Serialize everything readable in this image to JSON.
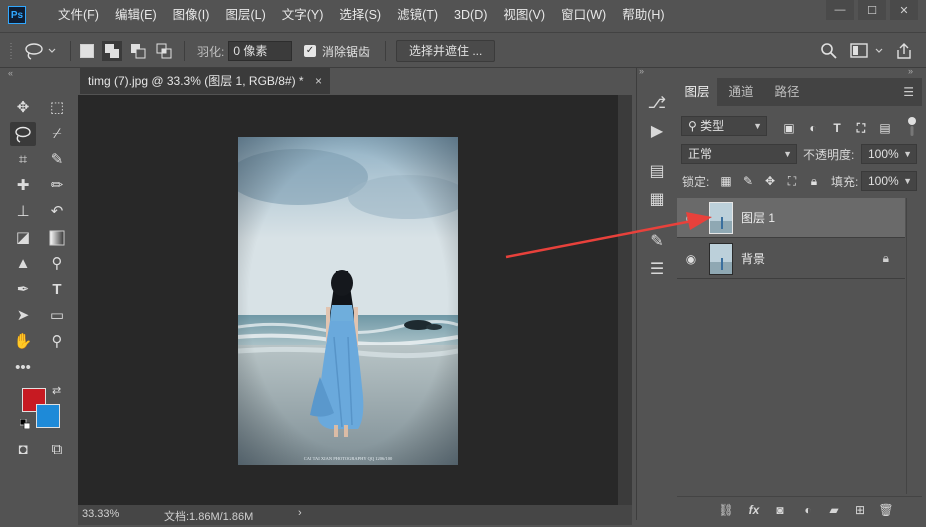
{
  "app": {
    "logo": "Ps"
  },
  "menu": [
    "文件(F)",
    "编辑(E)",
    "图像(I)",
    "图层(L)",
    "文字(Y)",
    "选择(S)",
    "滤镜(T)",
    "3D(D)",
    "视图(V)",
    "窗口(W)",
    "帮助(H)"
  ],
  "window_controls": {
    "minimize": "—",
    "maximize": "☐",
    "close": "✕"
  },
  "options": {
    "feather_label": "羽化:",
    "feather_value": "0 像素",
    "antialias_label": "消除锯齿",
    "antialias_checked": true,
    "select_mask_label": "选择并遮住 ..."
  },
  "document": {
    "tab_title": "timg (7).jpg @ 33.3% (图层 1, RGB/8#) *",
    "close": "×",
    "watermark": "CAI TAI XIAN PHOTOGRAPHY   QQ 1206/100"
  },
  "status": {
    "zoom": "33.33%",
    "doc_info": "文档:1.86M/1.86M",
    "arrow": "›"
  },
  "panel": {
    "tabs": [
      "图层",
      "通道",
      "路径"
    ],
    "active_tab": "图层",
    "filter_kind": "类型",
    "blend_mode": "正常",
    "opacity_label": "不透明度:",
    "opacity_value": "100%",
    "lock_label": "锁定:",
    "fill_label": "填充:",
    "fill_value": "100%"
  },
  "layers": [
    {
      "name": "图层 1",
      "selected": true,
      "locked": false
    },
    {
      "name": "背景",
      "selected": false,
      "locked": true
    }
  ],
  "colors": {
    "foreground": "#c71a22",
    "background": "#1e8ad8",
    "annotation_arrow": "#e8413b"
  }
}
